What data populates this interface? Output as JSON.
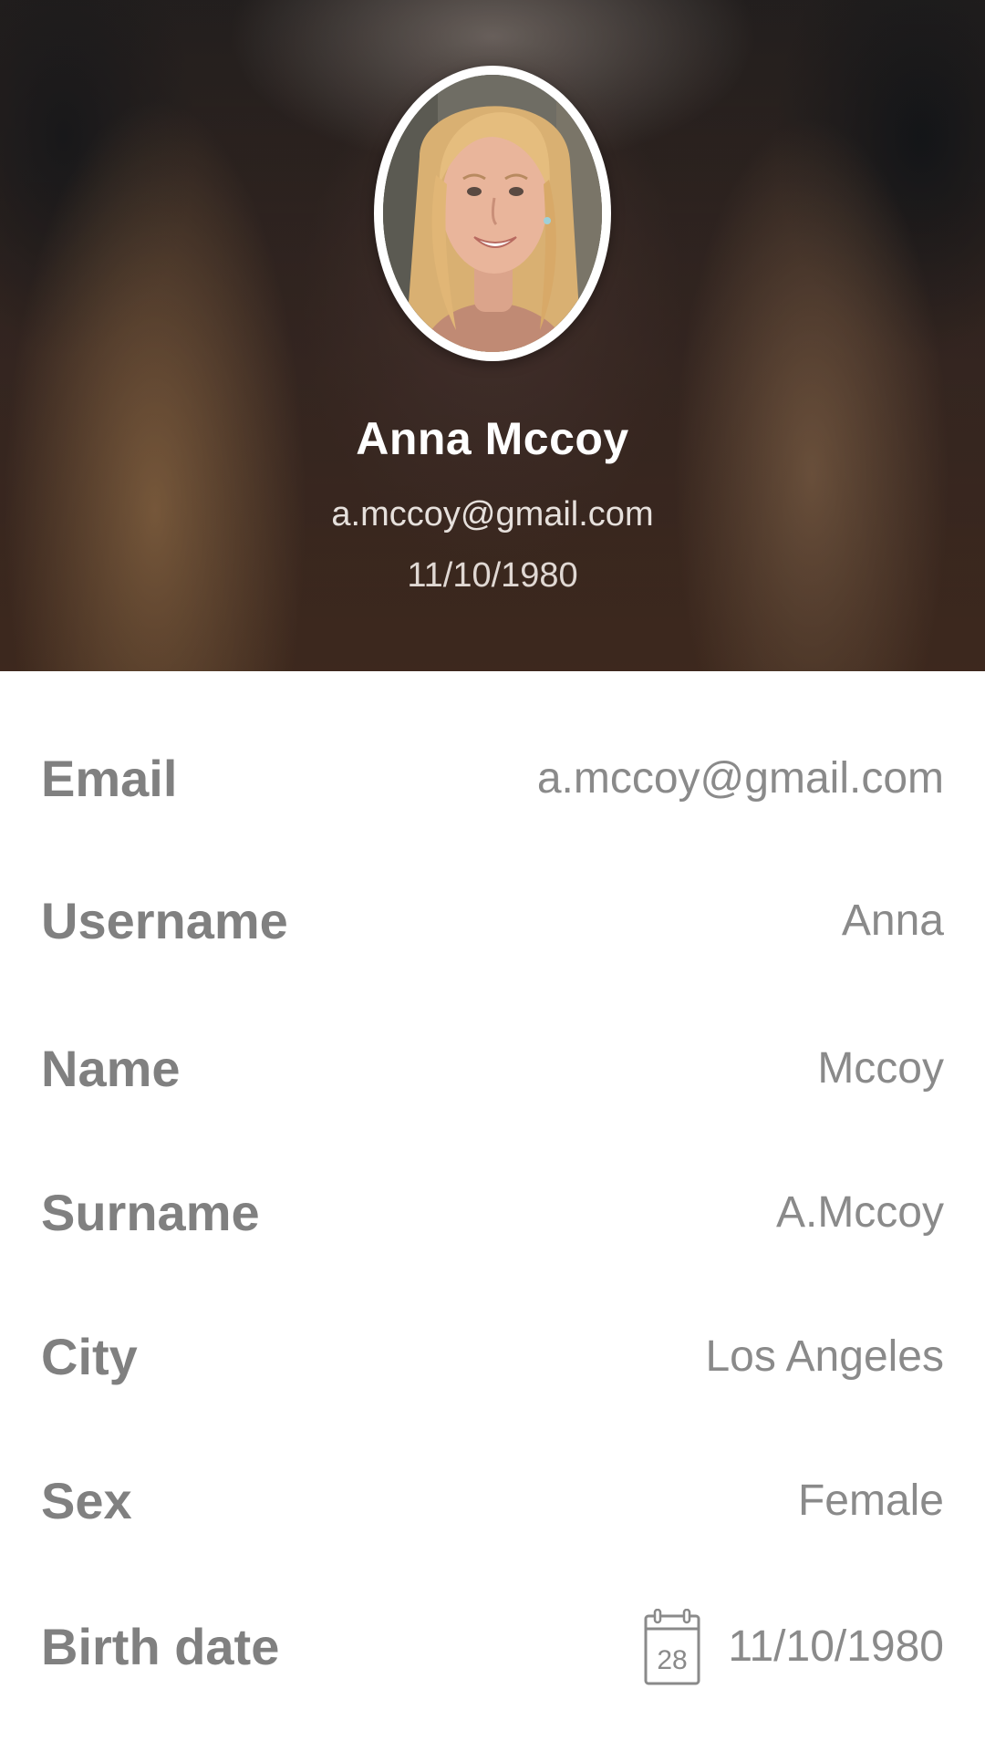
{
  "profile": {
    "name": "Anna Mccoy",
    "email": "a.mccoy@gmail.com",
    "birth_date": "11/10/1980"
  },
  "details": {
    "email": {
      "label": "Email",
      "value": "a.mccoy@gmail.com"
    },
    "username": {
      "label": "Username",
      "value": "Anna"
    },
    "name": {
      "label": "Name",
      "value": "Mccoy"
    },
    "surname": {
      "label": "Surname",
      "value": "A.Mccoy"
    },
    "city": {
      "label": "City",
      "value": "Los Angeles"
    },
    "sex": {
      "label": "Sex",
      "value": "Female"
    },
    "birth_date": {
      "label": "Birth date",
      "value": "11/10/1980",
      "calendar_day": "28"
    }
  },
  "icons": {
    "avatar": "profile-photo",
    "birth_date": "calendar-icon"
  },
  "colors": {
    "label_text": "#808080",
    "value_text": "#8a8a8a",
    "header_text": "#ffffff",
    "avatar_ring": "#ffffff"
  }
}
